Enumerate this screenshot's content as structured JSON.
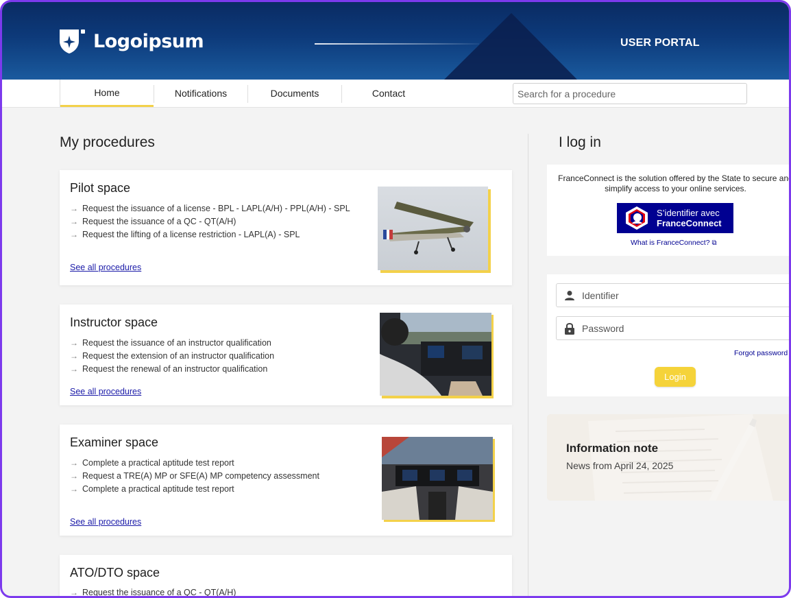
{
  "header": {
    "logo_text": "Logoipsum",
    "portal_title": "USER PORTAL"
  },
  "nav": {
    "tabs": [
      {
        "label": "Home",
        "active": true
      },
      {
        "label": "Notifications",
        "active": false
      },
      {
        "label": "Documents",
        "active": false
      },
      {
        "label": "Contact",
        "active": false
      }
    ],
    "search_placeholder": "Search for a procedure"
  },
  "procedures": {
    "title": "My procedures",
    "link_label": "See all procedures",
    "cards": [
      {
        "title": "Pilot space",
        "items": [
          "Request the issuance of a license - BPL - LAPL(A/H) - PPL(A/H) - SPL",
          "Request the issuance of a QC - QT(A/H)",
          "Request the lifting of a license restriction - LAPL(A) - SPL"
        ],
        "image": "vintage-plane-photo"
      },
      {
        "title": "Instructor space",
        "items": [
          "Request the issuance of an instructor qualification",
          "Request the extension of an instructor qualification",
          "Request the renewal of an instructor qualification"
        ],
        "image": "cockpit-pilot-photo"
      },
      {
        "title": "Examiner space",
        "items": [
          "Complete a practical aptitude test report",
          "Request a TRE(A) MP or SFE(A) MP competency assessment",
          "Complete a practical aptitude test report"
        ],
        "image": "jet-cockpit-photo"
      },
      {
        "title": "ATO/DTO space",
        "items": [
          "Request the issuance of a QC - QT(A/H)"
        ]
      }
    ]
  },
  "login": {
    "title": "I log in",
    "franceconnect_text": "FranceConnect is the solution offered by the State to secure and simplify access to your online services.",
    "franceconnect_button_line1": "S’identifier avec",
    "franceconnect_button_line2": "FranceConnect",
    "franceconnect_help": "What is FranceConnect?",
    "identifier_placeholder": "Identifier",
    "password_placeholder": "Password",
    "forgot_password": "Forgot password",
    "login_button": "Login"
  },
  "info_note": {
    "title": "Information note",
    "subtitle": "News from April 24, 2025"
  },
  "colors": {
    "brand_blue": "#0d3a7a",
    "accent_yellow": "#f3d14a",
    "franceconnect_blue": "#000091",
    "frame_purple": "#7c3aed"
  }
}
